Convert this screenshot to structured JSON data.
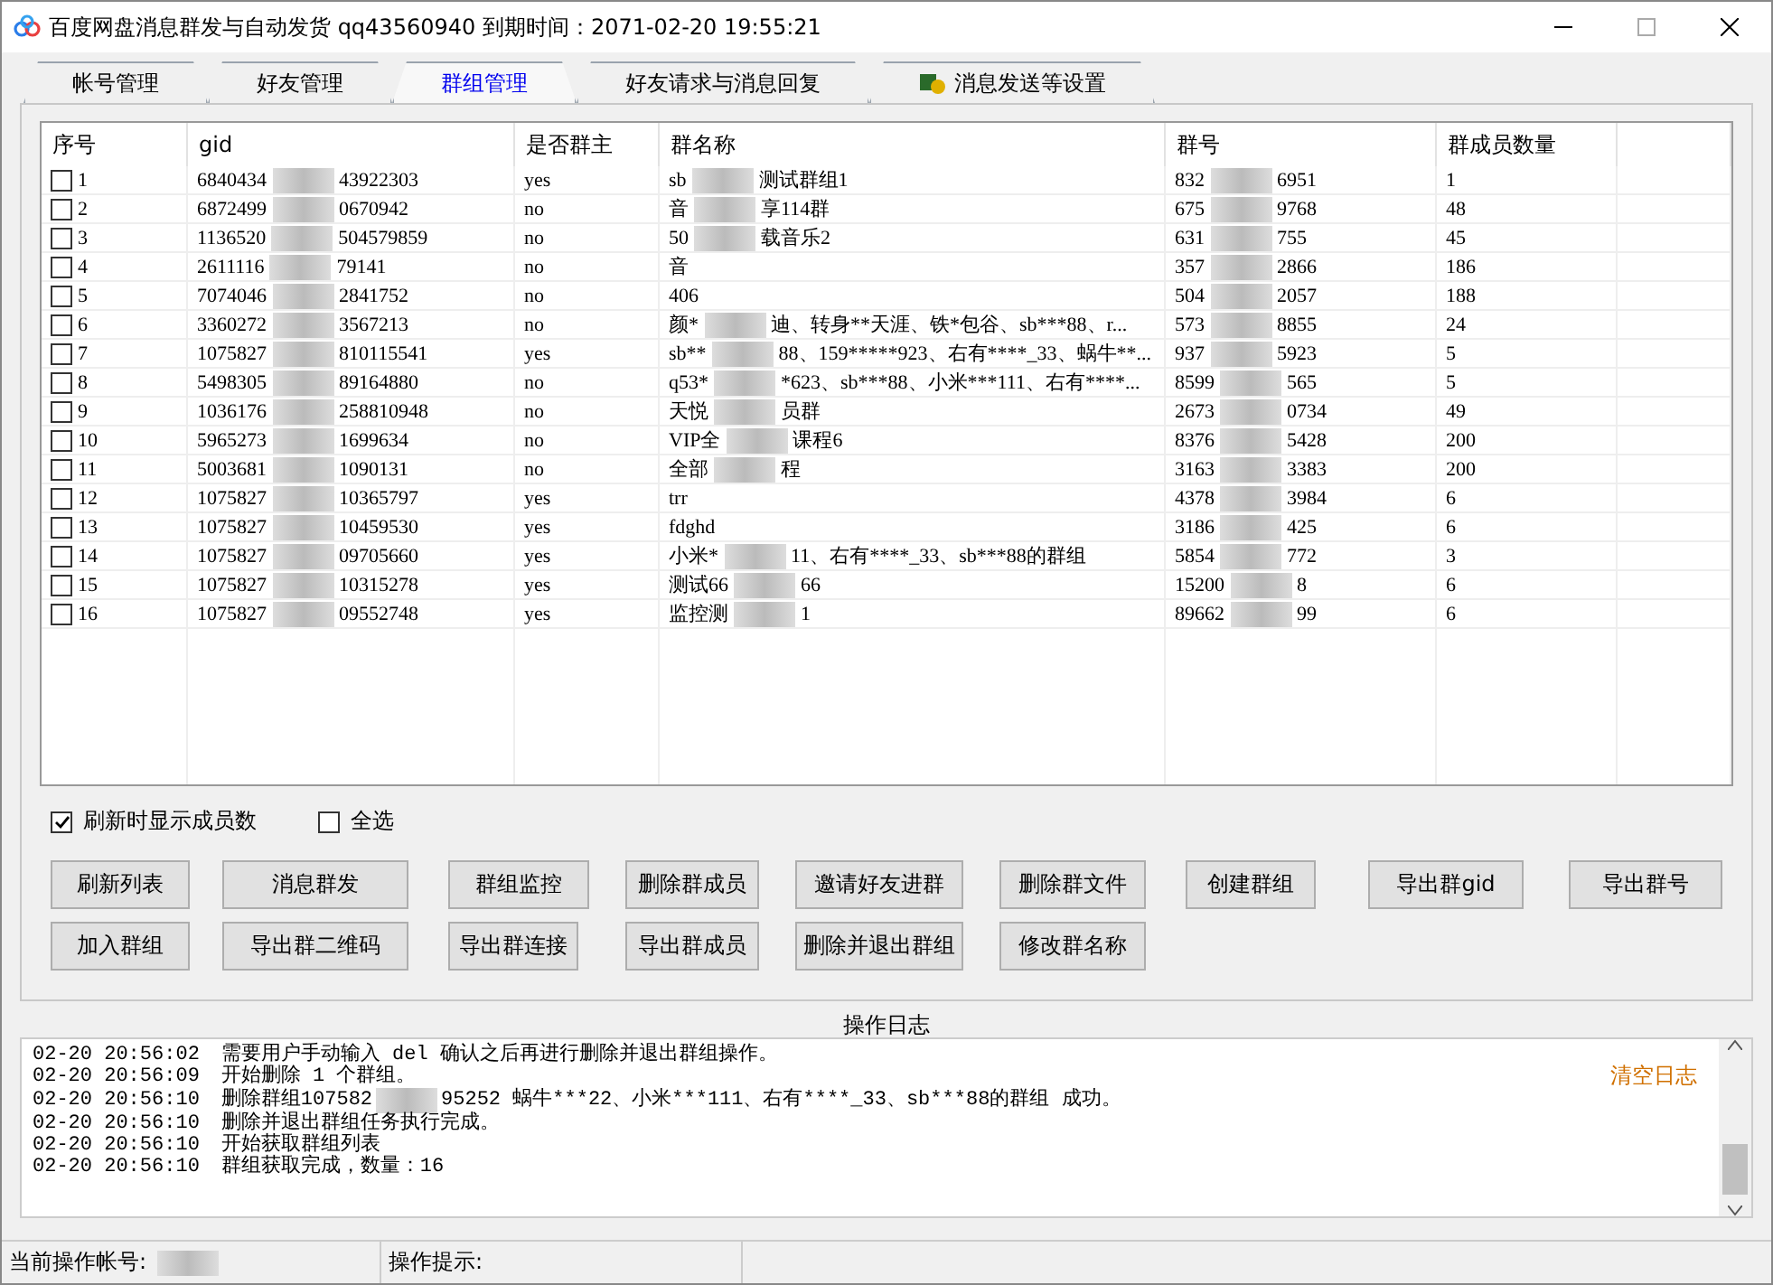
{
  "window": {
    "title": "百度网盘消息群发与自动发货 qq43560940 到期时间：2071-02-20 19:55:21"
  },
  "tabs": [
    {
      "label": "帐号管理",
      "selected": false
    },
    {
      "label": "好友管理",
      "selected": false
    },
    {
      "label": "群组管理",
      "selected": true
    },
    {
      "label": "好友请求与消息回复",
      "selected": false
    },
    {
      "label": "消息发送等设置",
      "selected": false,
      "icon": true
    }
  ],
  "table": {
    "columns": [
      "序号",
      "gid",
      "是否群主",
      "群名称",
      "群号",
      "群成员数量"
    ],
    "rows": [
      {
        "checked": false,
        "index": "1",
        "gid": [
          "6840434",
          "43922303"
        ],
        "owner": "yes",
        "name": [
          "sb",
          "测试群组1"
        ],
        "number": [
          "832",
          "6951"
        ],
        "members": "1"
      },
      {
        "checked": false,
        "index": "2",
        "gid": [
          "6872499",
          "0670942"
        ],
        "owner": "no",
        "name": [
          "音",
          "享114群"
        ],
        "number": [
          "675",
          "9768"
        ],
        "members": "48"
      },
      {
        "checked": false,
        "index": "3",
        "gid": [
          "1136520",
          "504579859"
        ],
        "owner": "no",
        "name": [
          "50",
          "载音乐2"
        ],
        "number": [
          "631",
          "755"
        ],
        "members": "45"
      },
      {
        "checked": false,
        "index": "4",
        "gid": [
          "2611116",
          "79141"
        ],
        "owner": "no",
        "name": [
          "音"
        ],
        "number": [
          "357",
          "2866"
        ],
        "members": "186"
      },
      {
        "checked": false,
        "index": "5",
        "gid": [
          "7074046",
          "2841752"
        ],
        "owner": "no",
        "name": [
          "406"
        ],
        "number": [
          "504",
          "2057"
        ],
        "members": "188"
      },
      {
        "checked": false,
        "index": "6",
        "gid": [
          "3360272",
          "3567213"
        ],
        "owner": "no",
        "name": [
          "颜*",
          "迪、转身**天涯、铁*包谷、sb***88、r..."
        ],
        "number": [
          "573",
          "8855"
        ],
        "members": "24"
      },
      {
        "checked": false,
        "index": "7",
        "gid": [
          "1075827",
          "810115541"
        ],
        "owner": "yes",
        "name": [
          "sb**",
          "88、159*****923、右有****_33、蜗牛**..."
        ],
        "number": [
          "937",
          "5923"
        ],
        "members": "5"
      },
      {
        "checked": false,
        "index": "8",
        "gid": [
          "5498305",
          "89164880"
        ],
        "owner": "no",
        "name": [
          "q53*",
          "*623、sb***88、小米***111、右有****..."
        ],
        "number": [
          "8599",
          "565"
        ],
        "members": "5"
      },
      {
        "checked": false,
        "index": "9",
        "gid": [
          "1036176",
          "258810948"
        ],
        "owner": "no",
        "name": [
          "天悦",
          "员群"
        ],
        "number": [
          "2673",
          "0734"
        ],
        "members": "49"
      },
      {
        "checked": false,
        "index": "10",
        "gid": [
          "5965273",
          "1699634"
        ],
        "owner": "no",
        "name": [
          "VIP全",
          "课程6"
        ],
        "number": [
          "8376",
          "5428"
        ],
        "members": "200"
      },
      {
        "checked": false,
        "index": "11",
        "gid": [
          "5003681",
          "1090131"
        ],
        "owner": "no",
        "name": [
          "全部",
          "程"
        ],
        "number": [
          "3163",
          "3383"
        ],
        "members": "200"
      },
      {
        "checked": false,
        "index": "12",
        "gid": [
          "1075827",
          "10365797"
        ],
        "owner": "yes",
        "name": [
          "trr"
        ],
        "number": [
          "4378",
          "3984"
        ],
        "members": "6"
      },
      {
        "checked": false,
        "index": "13",
        "gid": [
          "1075827",
          "10459530"
        ],
        "owner": "yes",
        "name": [
          "fdghd"
        ],
        "number": [
          "3186",
          "425"
        ],
        "members": "6"
      },
      {
        "checked": false,
        "index": "14",
        "gid": [
          "1075827",
          "09705660"
        ],
        "owner": "yes",
        "name": [
          "小米*",
          "11、右有****_33、sb***88的群组"
        ],
        "number": [
          "5854",
          "772"
        ],
        "members": "3"
      },
      {
        "checked": false,
        "index": "15",
        "gid": [
          "1075827",
          "10315278"
        ],
        "owner": "yes",
        "name": [
          "测试66",
          "66"
        ],
        "number": [
          "15200",
          "8"
        ],
        "members": "6"
      },
      {
        "checked": false,
        "index": "16",
        "gid": [
          "1075827",
          "09552748"
        ],
        "owner": "yes",
        "name": [
          "监控测",
          "1"
        ],
        "number": [
          "89662",
          "99"
        ],
        "members": "6"
      }
    ]
  },
  "options": [
    {
      "label": "刷新时显示成员数",
      "checked": true
    },
    {
      "label": "全选",
      "checked": false
    }
  ],
  "button_rows": [
    [
      "刷新列表",
      "消息群发",
      "群组监控",
      "删除群成员",
      "邀请好友进群",
      "删除群文件",
      "创建群组",
      "导出群gid",
      "导出群号"
    ],
    [
      "加入群组",
      "导出群二维码",
      "导出群连接",
      "导出群成员",
      "删除并退出群组",
      "修改群名称"
    ]
  ],
  "log": {
    "title": "操作日志",
    "clear": "清空日志",
    "lines": [
      {
        "time": "02-20 20:56:02",
        "text": [
          "需要用户手动输入 del 确认之后再进行删除并退出群组操作。"
        ]
      },
      {
        "time": "02-20 20:56:09",
        "text": [
          "开始删除 1 个群组。"
        ]
      },
      {
        "time": "02-20 20:56:10",
        "text": [
          "删除群组107582",
          "95252  蜗牛***22、小米***111、右有****_33、sb***88的群组 成功。"
        ]
      },
      {
        "time": "02-20 20:56:10",
        "text": [
          "删除并退出群组任务执行完成。"
        ]
      },
      {
        "time": "02-20 20:56:10",
        "text": [
          "开始获取群组列表"
        ]
      },
      {
        "time": "02-20 20:56:10",
        "text": [
          "群组获取完成，数量：16"
        ]
      }
    ]
  },
  "status_bar": {
    "account_label": "当前操作帐号:",
    "hint_label": "操作提示:"
  }
}
